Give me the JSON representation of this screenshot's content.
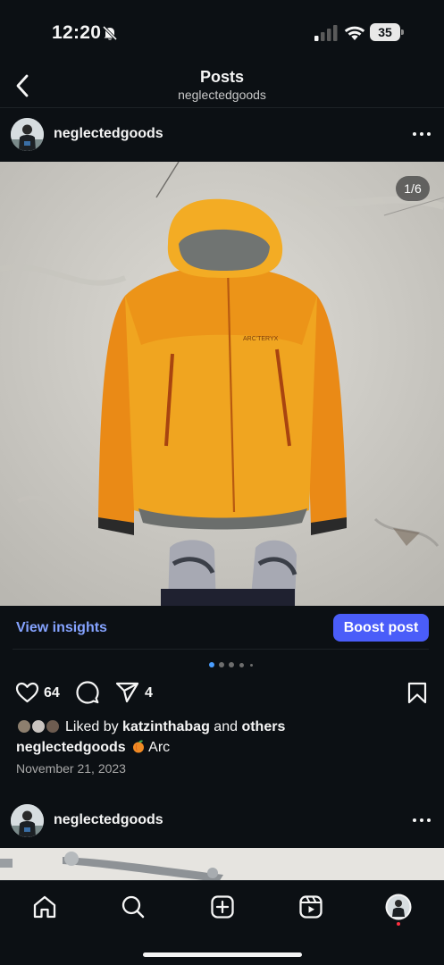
{
  "status_bar": {
    "time": "12:20",
    "battery": "35",
    "icons": [
      "bell-off-icon",
      "signal-icon",
      "wifi-icon",
      "battery-icon"
    ]
  },
  "header": {
    "title": "Posts",
    "subtitle": "neglectedgoods",
    "back_icon": "chevron-left-icon"
  },
  "post": {
    "username": "neglectedgoods",
    "image_counter": "1/6",
    "pager": {
      "total_visible": 5,
      "active_index": 0
    },
    "insights": {
      "view_label": "View insights",
      "boost_label": "Boost post"
    },
    "like_count": "64",
    "share_count": "4",
    "liked_by": {
      "prefix": "Liked by ",
      "user": "katzinthabag",
      "connector": " and ",
      "suffix": "others"
    },
    "caption": {
      "user": "neglectedgoods",
      "emoji": "peach-icon",
      "text": "Arc"
    },
    "date": "November 21, 2023"
  },
  "next_post": {
    "username": "neglectedgoods"
  },
  "tab_bar": {
    "items": [
      "home-icon",
      "search-icon",
      "create-icon",
      "reels-icon",
      "profile-avatar"
    ]
  },
  "colors": {
    "background": "#0c1014",
    "link_blue": "#85a3ff",
    "boost_button": "#4a5df9",
    "active_dot": "#4a9eff",
    "notification_dot": "#ff3040"
  }
}
